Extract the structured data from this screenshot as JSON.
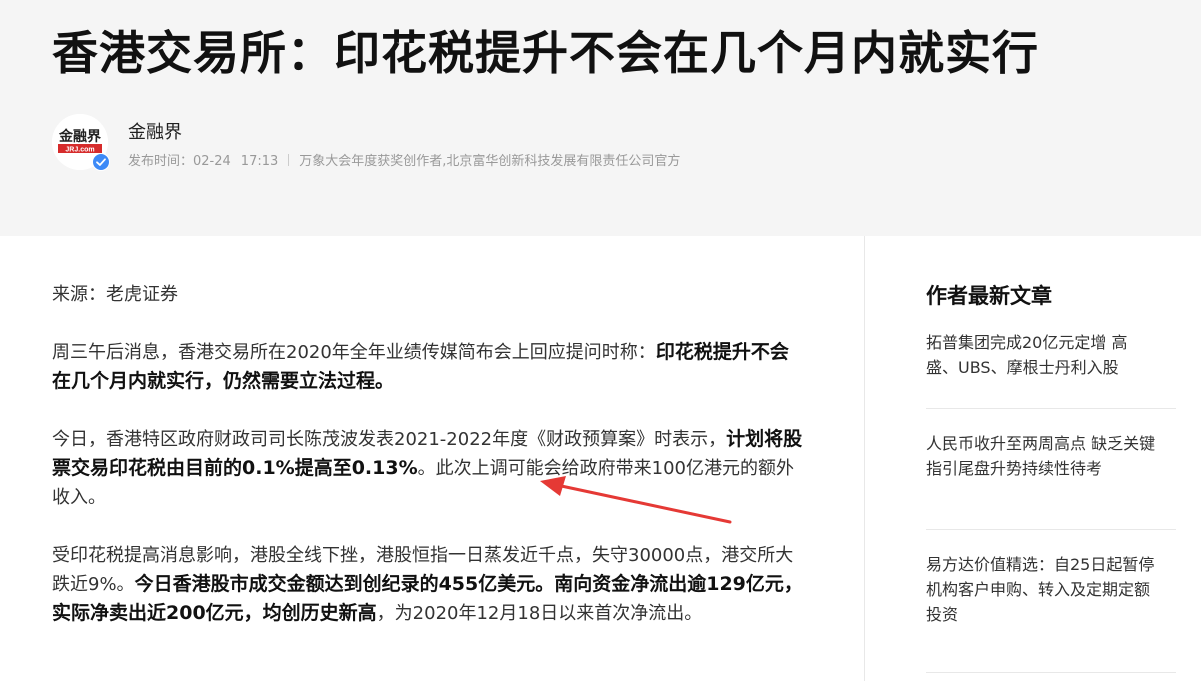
{
  "header": {
    "title": "香港交易所：印花税提升不会在几个月内就实行",
    "avatar_logo_text": "金融界",
    "avatar_domain_text": "JRJ.com",
    "author": "金融界",
    "publish_label": "发布时间：",
    "publish_date": "02-24",
    "publish_time": "17:13",
    "author_desc": "万象大会年度获奖创作者,北京富华创新科技发展有限责任公司官方"
  },
  "article": {
    "source": "来源：老虎证券",
    "p1_normal": "周三午后消息，香港交易所在2020年全年业绩传媒简布会上回应提问时称：",
    "p1_bold": "印花税提升不会在几个月内就实行，仍然需要立法过程。",
    "p2_normal_a": "今日，香港特区政府财政司司长陈茂波发表2021-2022年度《财政预算案》时表示，",
    "p2_bold": "计划将股票交易印花税由目前的0.1%提高至0.13%",
    "p2_normal_b": "。此次上调可能会给政府带来100亿港元的额外收入。",
    "p3_normal_a": "受印花税提高消息影响，港股全线下挫，港股恒指一日蒸发近千点，失守30000点，港交所大跌近9%。",
    "p3_bold": "今日香港股市成交金额达到创纪录的455亿美元。南向资金净流出逾129亿元，实际净卖出近200亿元，均创历史新高",
    "p3_normal_b": "，为2020年12月18日以来首次净流出。"
  },
  "sidebar": {
    "title": "作者最新文章",
    "items": [
      {
        "line1": "拓普集团完成20亿元定增 高",
        "line2": "盛、UBS、摩根士丹利入股"
      },
      {
        "line1": "人民币收升至两周高点 缺乏关键",
        "line2": "指引尾盘升势持续性待考"
      },
      {
        "line1": "易方达价值精选：自25日起暂停",
        "line2": "机构客户申购、转入及定期定额",
        "line3": "投资"
      }
    ]
  },
  "colors": {
    "header_bg": "#f5f5f5",
    "arrow": "#e53935",
    "verified": "#3d8af7",
    "logo_red": "#d62b2b"
  }
}
